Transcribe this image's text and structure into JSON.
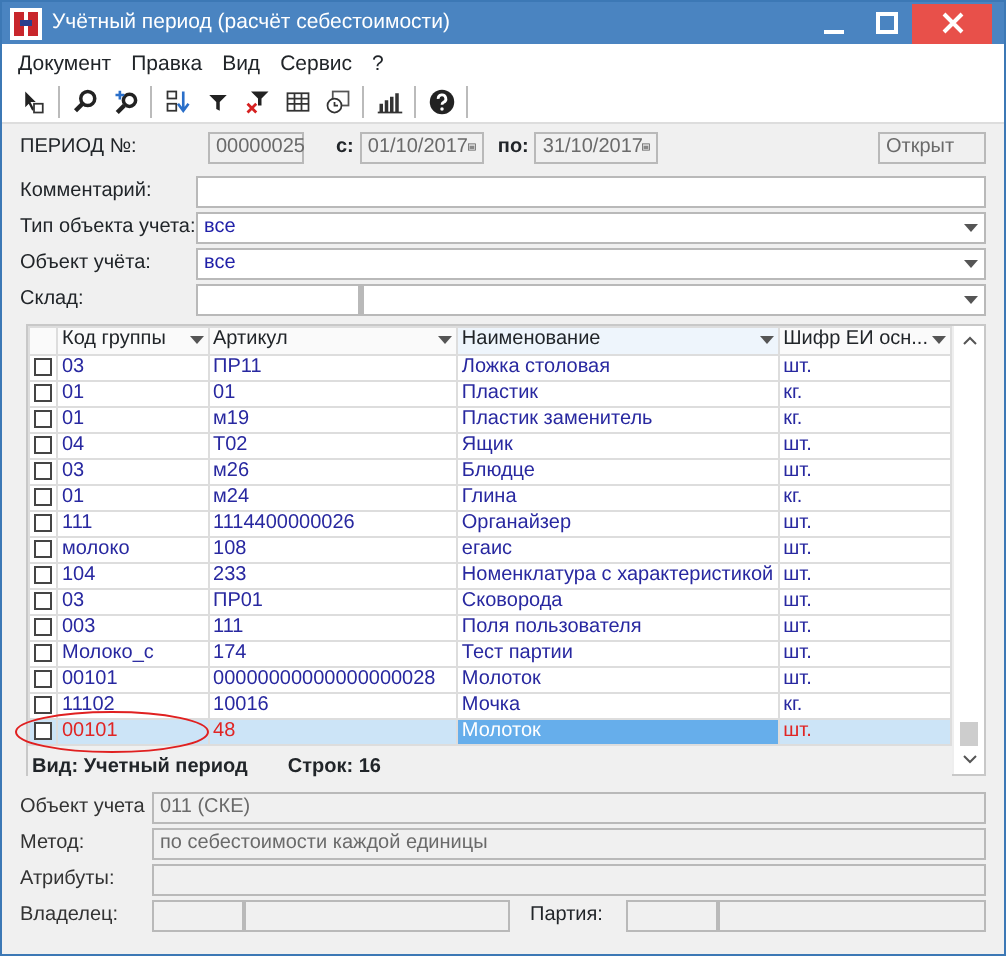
{
  "window": {
    "title": "Учётный период (расчёт себестоимости)"
  },
  "menu": [
    "Документ",
    "Правка",
    "Вид",
    "Сервис",
    "?"
  ],
  "toolbar": [
    {
      "kind": "pointer"
    },
    {
      "kind": "search"
    },
    {
      "kind": "search-plus"
    },
    {
      "kind": "sort"
    },
    {
      "kind": "filter"
    },
    {
      "kind": "clear-filter"
    },
    {
      "kind": "table"
    },
    {
      "kind": "clock"
    },
    {
      "kind": "chart"
    },
    {
      "kind": "help"
    }
  ],
  "header": {
    "period_label": "ПЕРИОД №:",
    "period_number": "00000025",
    "from_label": "с:",
    "from_date": "01/10/2017",
    "to_label": "по:",
    "to_date": "31/10/2017",
    "status": "Открыт"
  },
  "filters": [
    {
      "label": "Комментарий:",
      "kind": "text"
    },
    {
      "label": "Тип объекта учета:",
      "value": "все",
      "kind": "dropdown"
    },
    {
      "label": "Объект учёта:",
      "value": "все",
      "kind": "dropdown"
    },
    {
      "label": "Склад:",
      "kind": "split-dropdown"
    }
  ],
  "table": {
    "columns": [
      {
        "label": "Код группы",
        "selected": false
      },
      {
        "label": "Артикул",
        "selected": false
      },
      {
        "label": "Наименование",
        "selected": true
      },
      {
        "label": "Шифр ЕИ осн...",
        "selected": false
      }
    ],
    "rows": [
      {
        "checked": false,
        "selected": false,
        "cells": [
          "03",
          "ПР11",
          "Ложка столовая",
          "шт."
        ]
      },
      {
        "checked": false,
        "selected": false,
        "cells": [
          "01",
          "01",
          "Пластик",
          "кг."
        ]
      },
      {
        "checked": false,
        "selected": false,
        "cells": [
          "01",
          "м19",
          "Пластик заменитель",
          "кг."
        ]
      },
      {
        "checked": false,
        "selected": false,
        "cells": [
          "04",
          "Т02",
          "Ящик",
          "шт."
        ]
      },
      {
        "checked": false,
        "selected": false,
        "cells": [
          "03",
          "м26",
          "Блюдце",
          "шт."
        ]
      },
      {
        "checked": false,
        "selected": false,
        "cells": [
          "01",
          "м24",
          "Глина",
          "кг."
        ]
      },
      {
        "checked": false,
        "selected": false,
        "cells": [
          "111",
          "1114400000026",
          "Органайзер",
          "шт."
        ]
      },
      {
        "checked": false,
        "selected": false,
        "cells": [
          "молоко",
          "108",
          "егаис",
          "шт."
        ]
      },
      {
        "checked": false,
        "selected": false,
        "cells": [
          "104",
          "233",
          "Номенклатура с характеристикой",
          "шт."
        ]
      },
      {
        "checked": false,
        "selected": false,
        "cells": [
          "03",
          "ПР01",
          "Сковорода",
          "шт."
        ]
      },
      {
        "checked": false,
        "selected": false,
        "cells": [
          "003",
          "111",
          "Поля пользователя",
          "шт."
        ]
      },
      {
        "checked": false,
        "selected": false,
        "cells": [
          "Молоко_с",
          "174",
          "Тест партии",
          "шт."
        ]
      },
      {
        "checked": false,
        "selected": false,
        "cells": [
          "00101",
          "00000000000000000028",
          "Молоток",
          "шт."
        ]
      },
      {
        "checked": false,
        "selected": false,
        "cells": [
          "11102",
          "10016",
          "Мочка",
          "кг."
        ]
      },
      {
        "checked": false,
        "selected": true,
        "cells": [
          "00101",
          "48",
          "Молоток",
          "шт."
        ]
      }
    ],
    "status": {
      "view": "Вид: Учетный период",
      "count": "Строк: 16"
    }
  },
  "details": [
    {
      "label": "Объект учета",
      "value": "011 (СКЕ)"
    },
    {
      "label": "Метод:",
      "value": "по себестоимости каждой единицы"
    },
    {
      "label": "Атрибуты:"
    }
  ],
  "owner": {
    "label": "Владелец:",
    "batch_label": "Партия:"
  }
}
